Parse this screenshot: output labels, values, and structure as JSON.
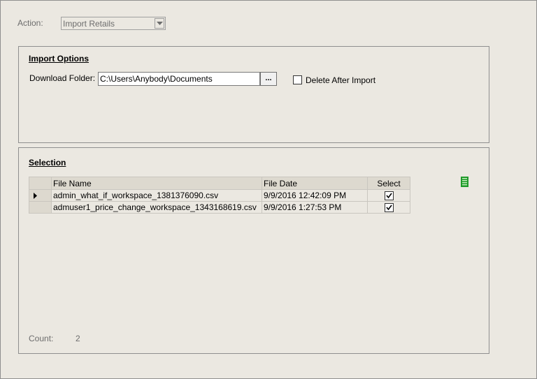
{
  "action": {
    "label": "Action:",
    "value": "Import Retails"
  },
  "import_options": {
    "title": "Import Options",
    "download_folder_label": "Download Folder:",
    "download_folder_value": "C:\\Users\\Anybody\\Documents",
    "browse_label": "...",
    "delete_after_import_label": "Delete After Import",
    "delete_after_import_checked": false
  },
  "selection": {
    "title": "Selection",
    "columns": [
      "File Name",
      "File Date",
      "Select"
    ],
    "rows": [
      {
        "file_name": "admin_what_if_workspace_1381376090.csv",
        "file_date": "9/9/2016 12:42:09 PM",
        "selected": true
      },
      {
        "file_name": "admuser1_price_change_workspace_1343168619.csv",
        "file_date": "9/9/2016 1:27:53 PM",
        "selected": true
      }
    ],
    "count_label": "Count:",
    "count_value": "2"
  },
  "icons": {
    "list_icon": "list-icon",
    "combo_arrow": "chevron-down-icon",
    "row_indicator": "row-pointer-icon"
  },
  "colors": {
    "background": "#ebe8e1",
    "list_icon": "#1f9a2a"
  }
}
